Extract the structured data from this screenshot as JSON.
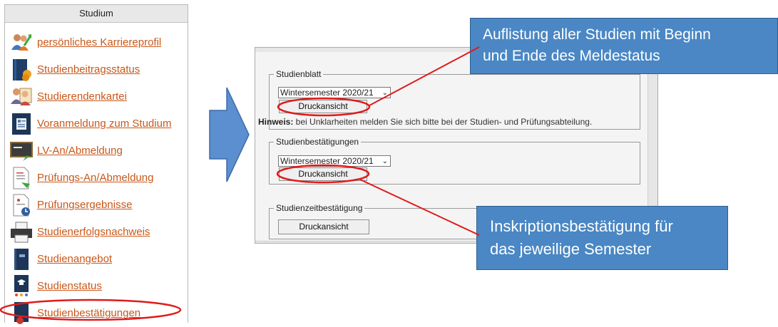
{
  "menu": {
    "header": "Studium",
    "items": [
      {
        "label": "persönliches Karriereprofil",
        "icon": "people-rising-arrow-icon"
      },
      {
        "label": "Studienbeitragsstatus",
        "icon": "book-coins-icon"
      },
      {
        "label": "Studierendenkartei",
        "icon": "people-card-icon"
      },
      {
        "label": "Voranmeldung zum Studium",
        "icon": "document-id-icon"
      },
      {
        "label": "LV-An/Abmeldung",
        "icon": "blackboard-icon"
      },
      {
        "label": "Prüfungs-An/Abmeldung",
        "icon": "exam-document-icon"
      },
      {
        "label": "Prüfungsergebnisse",
        "icon": "exam-results-clock-icon"
      },
      {
        "label": "Studienerfolgsnachweis",
        "icon": "printer-icon"
      },
      {
        "label": "Studienangebot",
        "icon": "dark-book-icon"
      },
      {
        "label": "Studienstatus",
        "icon": "graduation-cap-icon"
      },
      {
        "label": "Studienbestätigungen",
        "icon": "certificate-icon"
      }
    ],
    "link_color": "#c8581a"
  },
  "panel": {
    "studienblatt": {
      "legend": "Studienblatt",
      "semester": "Wintersemester 2020/21",
      "button": "Druckansicht"
    },
    "hint": {
      "bold": "Hinweis:",
      "text": " bei Unklarheiten melden Sie sich bitte bei der Studien- und Prüfungsabteilung."
    },
    "bestaetigungen": {
      "legend": "Studienbestätigungen",
      "semester": "Wintersemester 2020/21",
      "button": "Druckansicht"
    },
    "zeitbestaetigung": {
      "legend": "Studienzeitbestätigung",
      "button": "Druckansicht"
    }
  },
  "callouts": {
    "top": [
      "Auflistung aller Studien mit Beginn",
      "und Ende des Meldestatus"
    ],
    "bottom": [
      "Inskriptionsbestätigung für",
      "das jeweilige Semester"
    ]
  },
  "colors": {
    "callout": "#4a87c4",
    "annotation_red": "#e01b1b",
    "arrow": "#5b8fd0"
  }
}
